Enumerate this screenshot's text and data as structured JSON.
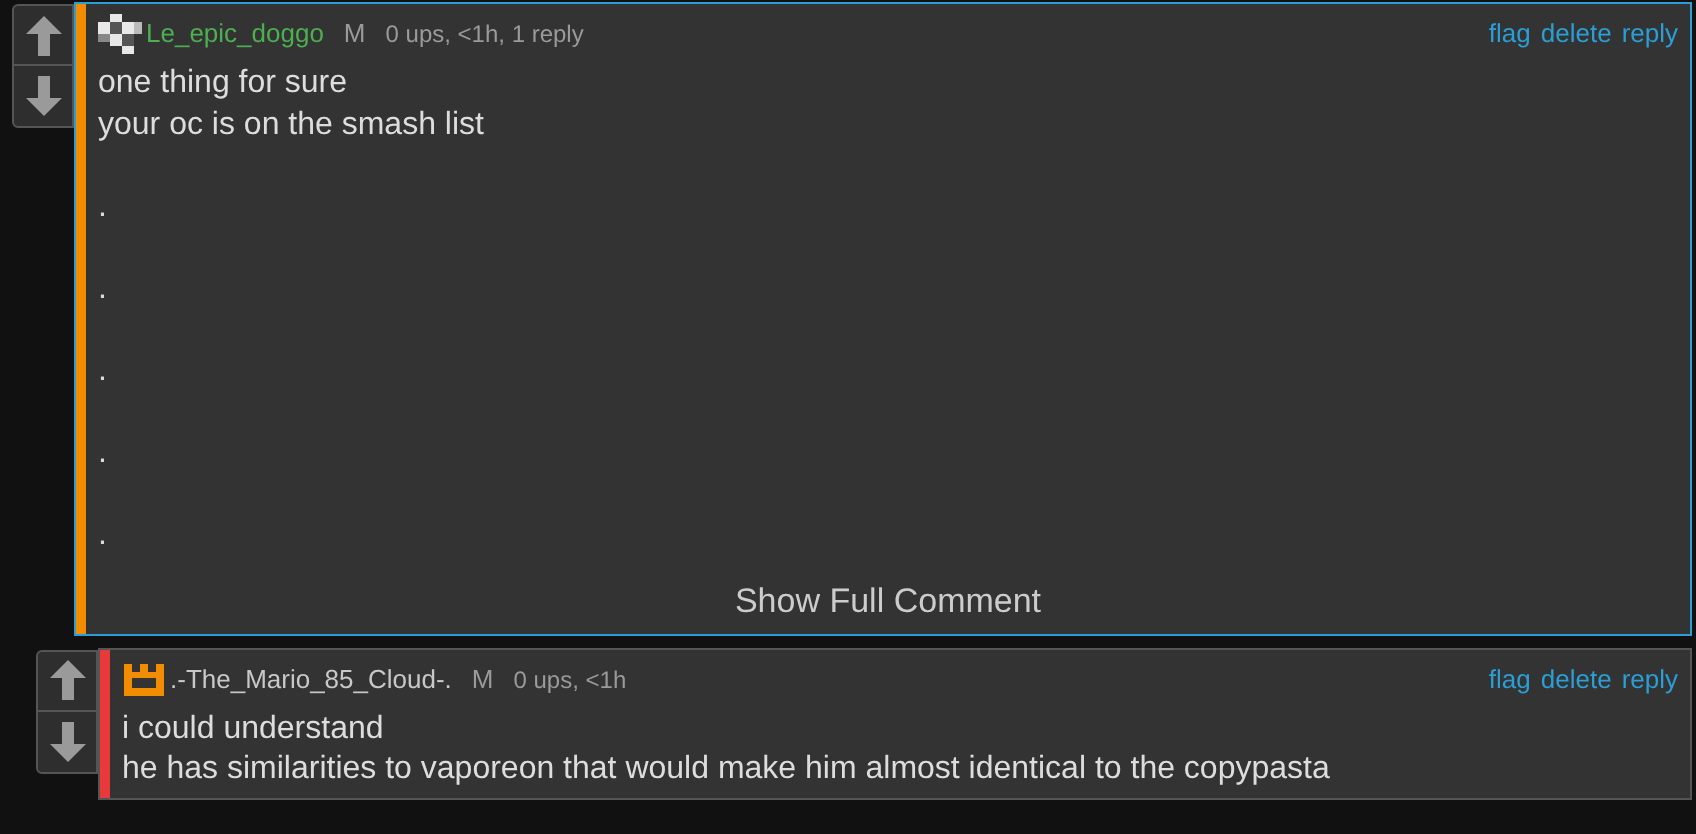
{
  "comments": [
    {
      "avatar": {
        "kind": "checker"
      },
      "user": {
        "name": "Le_epic_doggo",
        "color": "#4caf50"
      },
      "color": "#f28c00",
      "highlighted": true,
      "badge": "M",
      "stats": "0 ups, <1h, 1 reply",
      "actions": [
        "flag",
        "delete",
        "reply"
      ],
      "paragraphs": [
        [
          "one thing for sure",
          "your oc is on the smash list"
        ],
        [
          "."
        ],
        [
          "."
        ],
        [
          "."
        ],
        [
          "."
        ],
        [
          "."
        ]
      ],
      "show_full": "Show Full Comment"
    },
    {
      "avatar": {
        "kind": "crown"
      },
      "user": {
        "name": ".-The_Mario_85_Cloud-.",
        "color": "#c8c8c8"
      },
      "color": "#e83a3a",
      "highlighted": false,
      "badge": "M",
      "stats": "0 ups, <1h",
      "actions": [
        "flag",
        "delete",
        "reply"
      ],
      "paragraphs": [
        [
          "i could understand",
          "he has similarities to vaporeon that would make him almost identical to the copypasta"
        ]
      ]
    }
  ]
}
